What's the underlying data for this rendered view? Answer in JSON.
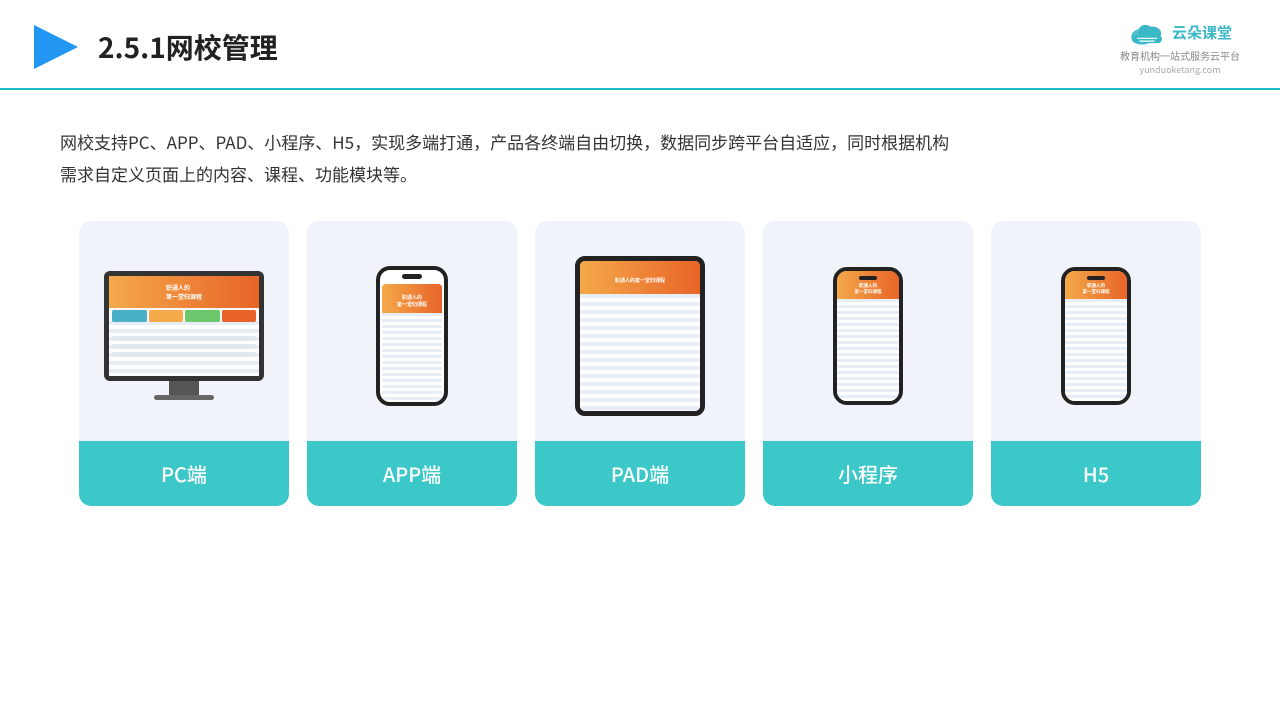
{
  "header": {
    "title": "2.5.1网校管理",
    "logo_text": "云朵课堂",
    "logo_url": "yunduoketang.com",
    "logo_tagline": "教育机构一站\n式服务云平台"
  },
  "description": {
    "text": "网校支持PC、APP、PAD、小程序、H5，实现多端打通，产品各终端自由切换，数据同步跨平台自适应，同时根据机构需求自定义页面上的内容、课程、功能模块等。"
  },
  "cards": [
    {
      "id": "pc",
      "label": "PC端"
    },
    {
      "id": "app",
      "label": "APP端"
    },
    {
      "id": "pad",
      "label": "PAD端"
    },
    {
      "id": "miniprogram",
      "label": "小程序"
    },
    {
      "id": "h5",
      "label": "H5"
    }
  ]
}
